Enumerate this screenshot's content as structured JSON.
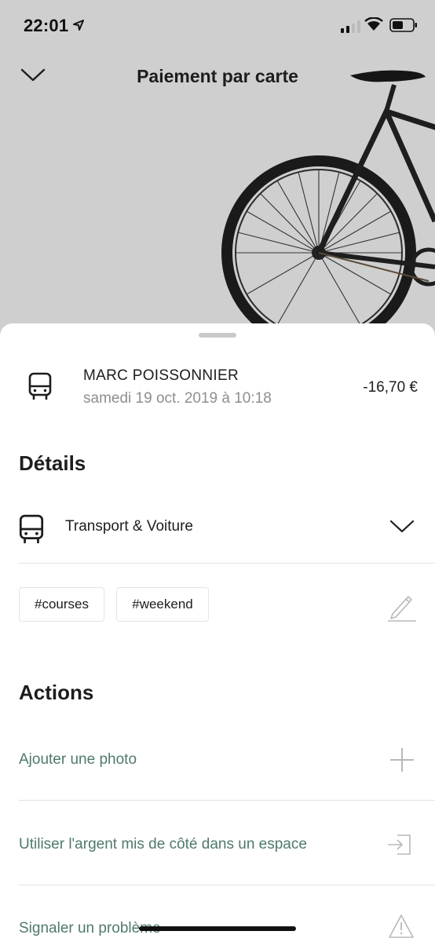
{
  "status_bar": {
    "time": "22:01"
  },
  "header": {
    "title": "Paiement par carte"
  },
  "transaction": {
    "merchant": "MARC POISSONNIER",
    "date": "samedi 19 oct. 2019 à 10:18",
    "amount": "-16,70 €"
  },
  "details": {
    "heading": "Détails",
    "category": "Transport & Voiture",
    "tags": [
      "#courses",
      "#weekend"
    ]
  },
  "actions": {
    "heading": "Actions",
    "items": [
      {
        "label": "Ajouter une photo",
        "icon": "plus-icon"
      },
      {
        "label": "Utiliser l'argent mis de côté dans un espace",
        "icon": "transfer-icon"
      },
      {
        "label": "Signaler un problème",
        "icon": "warning-icon"
      }
    ]
  },
  "colors": {
    "accent_green": "#4f7a6a",
    "background_grey": "#cfcfcf"
  }
}
